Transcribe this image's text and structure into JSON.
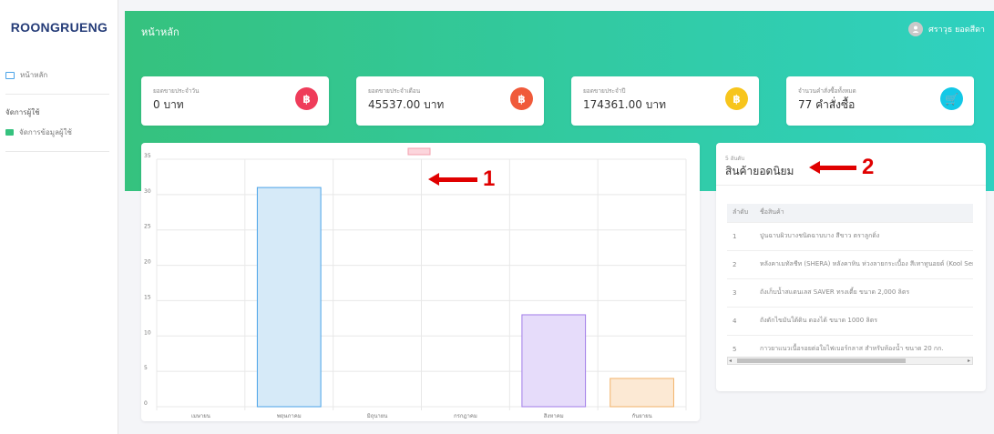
{
  "sidebar": {
    "brand": "ROONGRUENG",
    "home_label": "หน้าหลัก",
    "section_label": "จัดการผู้ใช้",
    "manage_users_label": "จัดการข้อมูลผู้ใช้"
  },
  "header": {
    "title": "หน้าหลัก",
    "user_name": "ศราวุธ ยอดสีดา"
  },
  "cards": [
    {
      "label": "ยอดขายประจำวัน",
      "value": "0 บาท",
      "icon": "baht-icon",
      "color": "#ef3c5a",
      "glyph": "฿"
    },
    {
      "label": "ยอดขายประจำเดือน",
      "value": "45537.00 บาท",
      "icon": "baht-icon",
      "color": "#f05a3a",
      "glyph": "฿"
    },
    {
      "label": "ยอดขายประจำปี",
      "value": "174361.00 บาท",
      "icon": "baht-icon",
      "color": "#f7c51c",
      "glyph": "฿"
    },
    {
      "label": "จำนวนคำสั่งซื้อทั้งหมด",
      "value": "77 คำสั่งซื้อ",
      "icon": "cart-icon",
      "color": "#13c8e6",
      "glyph": "🛒"
    }
  ],
  "chart_data": {
    "type": "bar",
    "categories": [
      "เมษายน",
      "พฤษภาคม",
      "มิถุนายน",
      "กรกฎาคม",
      "สิงหาคม",
      "กันยายน"
    ],
    "values": [
      0,
      31,
      0,
      0,
      13,
      4
    ],
    "colors": [
      "#4aa3e8",
      "#4aa3e8",
      "#4aa3e8",
      "#4aa3e8",
      "#a07ce8",
      "#f2b36a"
    ],
    "fills": [
      "#d6eaf8",
      "#d6eaf8",
      "#d6eaf8",
      "#d6eaf8",
      "#e6dcfa",
      "#fce9d4"
    ],
    "yticks": [
      "0",
      "5",
      "10",
      "15",
      "20",
      "25",
      "30",
      "35"
    ],
    "ylim": [
      0,
      35
    ],
    "grid": true,
    "legend": "top"
  },
  "popular": {
    "subtitle": "5 อันดับ",
    "title": "สินค้ายอดนิยม",
    "columns": [
      "ลำดับ",
      "ชื่อสินค้า"
    ],
    "rows": [
      [
        "1",
        "ปูนฉาบผิวบางชนิดฉาบบาง สีขาว ตราลูกดิ่ง"
      ],
      [
        "2",
        "หลังคาเมทัลชีท (SHERA) หลังคาหิน ห่วงลายกระเบื้อง สีเทาทูนอยด์ (Kool Ser"
      ],
      [
        "3",
        "ถังเก็บน้ำสแตนเลส SAVER ทรงเตี้ย ขนาด 2,000 ลิตร"
      ],
      [
        "4",
        "ถังดักไขมันใต้ดิน ดองได้ ขนาด 1000 ลิตร"
      ],
      [
        "5",
        "กาวยาแนวเนื้อรอยต่อใยไฟเบอร์กลาส สำหรับห้องน้ำ ขนาด 20 กก."
      ]
    ]
  },
  "annotations": {
    "one": "1",
    "two": "2"
  }
}
